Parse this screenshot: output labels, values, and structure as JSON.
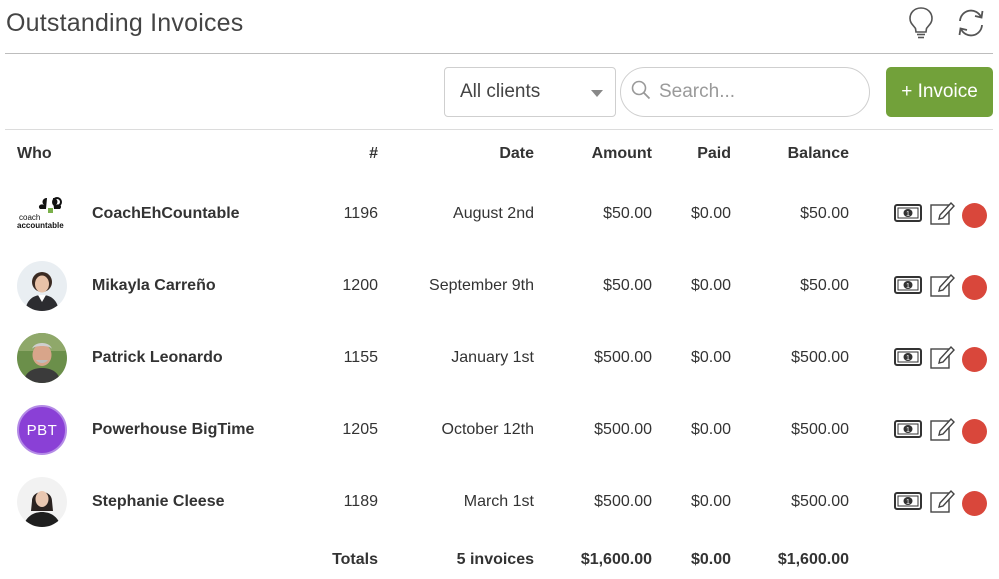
{
  "page": {
    "title": "Outstanding Invoices"
  },
  "header_icons": {
    "tip": "lightbulb-icon",
    "refresh": "refresh-icon"
  },
  "toolbar": {
    "client_filter": "All clients",
    "search_placeholder": "Search...",
    "new_invoice_label": "+ Invoice",
    "accent_color": "#72a13a"
  },
  "table": {
    "headers": {
      "who": "Who",
      "number": "#",
      "date": "Date",
      "amount": "Amount",
      "paid": "Paid",
      "balance": "Balance"
    },
    "rows": [
      {
        "name": "CoachEhCountable",
        "number": "1196",
        "date": "August 2nd",
        "amount": "$50.00",
        "paid": "$0.00",
        "balance": "$50.00",
        "avatar": "coachaccountable-logo"
      },
      {
        "name": "Mikayla Carreño",
        "number": "1200",
        "date": "September 9th",
        "amount": "$50.00",
        "paid": "$0.00",
        "balance": "$50.00",
        "avatar": "photo"
      },
      {
        "name": "Patrick Leonardo",
        "number": "1155",
        "date": "January 1st",
        "amount": "$500.00",
        "paid": "$0.00",
        "balance": "$500.00",
        "avatar": "photo"
      },
      {
        "name": "Powerhouse BigTime",
        "number": "1205",
        "date": "October 12th",
        "amount": "$500.00",
        "paid": "$0.00",
        "balance": "$500.00",
        "avatar": "initials",
        "initials": "PBT"
      },
      {
        "name": "Stephanie Cleese",
        "number": "1189",
        "date": "March 1st",
        "amount": "$500.00",
        "paid": "$0.00",
        "balance": "$500.00",
        "avatar": "photo"
      }
    ],
    "row_actions": {
      "pay": "money-bill-icon",
      "edit": "edit-icon",
      "delete": "delete-dot-icon",
      "delete_color": "#d9473b"
    },
    "totals": {
      "label": "Totals",
      "count": "5 invoices",
      "amount": "$1,600.00",
      "paid": "$0.00",
      "balance": "$1,600.00"
    }
  },
  "logo_text": {
    "line1": "coach",
    "line2": "accountable"
  }
}
